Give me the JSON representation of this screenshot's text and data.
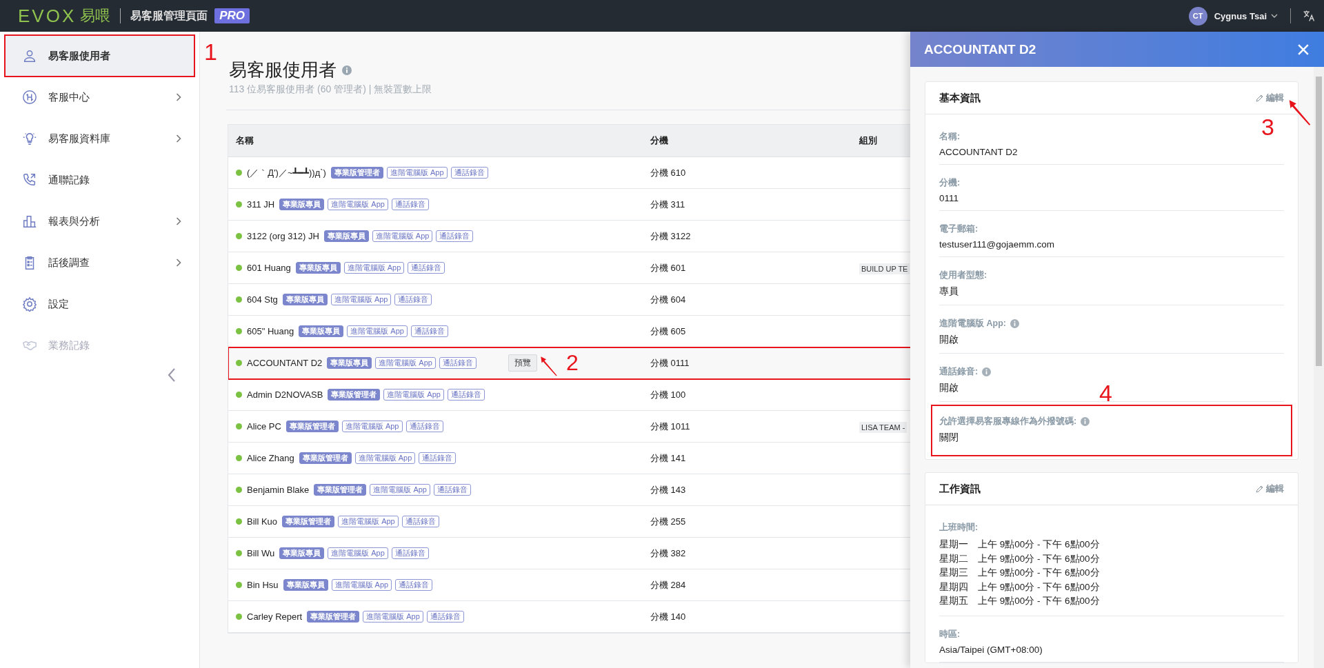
{
  "topbar": {
    "logo_mark": "EVOX",
    "logo_text": "易喂",
    "title": "易客服管理頁面",
    "badge": "PRO",
    "user": {
      "initials": "CT",
      "name": "Cygnus Tsai"
    }
  },
  "sidebar": {
    "items": [
      {
        "label": "易客服使用者",
        "selected": true,
        "disabled": false,
        "expandable": false,
        "callout": {
          "number": "1"
        }
      },
      {
        "label": "客服中心",
        "selected": false,
        "disabled": false,
        "expandable": true
      },
      {
        "label": "易客服資料庫",
        "selected": false,
        "disabled": false,
        "expandable": true
      },
      {
        "label": "通聯記錄",
        "selected": false,
        "disabled": false,
        "expandable": false
      },
      {
        "label": "報表與分析",
        "selected": false,
        "disabled": false,
        "expandable": true
      },
      {
        "label": "話後調查",
        "selected": false,
        "disabled": false,
        "expandable": true
      },
      {
        "label": "設定",
        "selected": false,
        "disabled": false,
        "expandable": false
      },
      {
        "label": "業務記錄",
        "selected": false,
        "disabled": true,
        "expandable": false
      }
    ]
  },
  "page": {
    "title": "易客服使用者",
    "subtitle": "113 位易客服使用者 (60 管理者) | 無裝置數上限"
  },
  "table": {
    "columns": [
      "名稱",
      "分機",
      "組別"
    ],
    "preview_label": "預覽",
    "rows": [
      {
        "name": "(／｀Д')／~┻━┻))д`)",
        "tags": [
          {
            "label": "專業版管理者",
            "kind": "filled"
          },
          {
            "label": "進階電腦版 App",
            "kind": "outline"
          },
          {
            "label": "通話錄音",
            "kind": "outline"
          }
        ],
        "extension": "分機 610",
        "selected": false
      },
      {
        "name": "311 JH",
        "tags": [
          {
            "label": "專業版專員",
            "kind": "filled"
          },
          {
            "label": "進階電腦版 App",
            "kind": "outline"
          },
          {
            "label": "通話錄音",
            "kind": "outline"
          }
        ],
        "extension": "分機 311",
        "selected": false
      },
      {
        "name": "3122 (org 312) JH",
        "tags": [
          {
            "label": "專業版專員",
            "kind": "filled"
          },
          {
            "label": "進階電腦版 App",
            "kind": "outline"
          },
          {
            "label": "通話錄音",
            "kind": "outline"
          }
        ],
        "extension": "分機 3122",
        "selected": false
      },
      {
        "name": "601 Huang",
        "tags": [
          {
            "label": "專業版專員",
            "kind": "filled"
          },
          {
            "label": "進階電腦版 App",
            "kind": "outline"
          },
          {
            "label": "通話錄音",
            "kind": "outline"
          }
        ],
        "extension": "分機 601",
        "group": "BUILD UP TE",
        "selected": false
      },
      {
        "name": "604 Stg",
        "tags": [
          {
            "label": "專業版專員",
            "kind": "filled"
          },
          {
            "label": "進階電腦版 App",
            "kind": "outline"
          },
          {
            "label": "通話錄音",
            "kind": "outline"
          }
        ],
        "extension": "分機 604",
        "selected": false
      },
      {
        "name": "605\" Huang",
        "tags": [
          {
            "label": "專業版專員",
            "kind": "filled"
          },
          {
            "label": "進階電腦版 App",
            "kind": "outline"
          },
          {
            "label": "通話錄音",
            "kind": "outline"
          }
        ],
        "extension": "分機 605",
        "selected": false
      },
      {
        "name": "ACCOUNTANT D2",
        "tags": [
          {
            "label": "專業版專員",
            "kind": "filled"
          },
          {
            "label": "進階電腦版 App",
            "kind": "outline"
          },
          {
            "label": "通話錄音",
            "kind": "outline"
          }
        ],
        "extension": "分機 0111",
        "selected": true,
        "callout": {
          "number": "2"
        }
      },
      {
        "name": "Admin D2NOVASB",
        "tags": [
          {
            "label": "專業版管理者",
            "kind": "filled"
          },
          {
            "label": "進階電腦版 App",
            "kind": "outline"
          },
          {
            "label": "通話錄音",
            "kind": "outline"
          }
        ],
        "extension": "分機 100",
        "selected": false
      },
      {
        "name": "Alice PC",
        "tags": [
          {
            "label": "專業版管理者",
            "kind": "filled"
          },
          {
            "label": "進階電腦版 App",
            "kind": "outline"
          },
          {
            "label": "通話錄音",
            "kind": "outline"
          }
        ],
        "extension": "分機 1011",
        "group": "LISA TEAM -",
        "selected": false
      },
      {
        "name": "Alice Zhang",
        "tags": [
          {
            "label": "專業版管理者",
            "kind": "filled"
          },
          {
            "label": "進階電腦版 App",
            "kind": "outline"
          },
          {
            "label": "通話錄音",
            "kind": "outline"
          }
        ],
        "extension": "分機 141",
        "selected": false
      },
      {
        "name": "Benjamin Blake",
        "tags": [
          {
            "label": "專業版管理者",
            "kind": "filled"
          },
          {
            "label": "進階電腦版 App",
            "kind": "outline"
          },
          {
            "label": "通話錄音",
            "kind": "outline"
          }
        ],
        "extension": "分機 143",
        "selected": false
      },
      {
        "name": "Bill Kuo",
        "tags": [
          {
            "label": "專業版管理者",
            "kind": "filled"
          },
          {
            "label": "進階電腦版 App",
            "kind": "outline"
          },
          {
            "label": "通話錄音",
            "kind": "outline"
          }
        ],
        "extension": "分機 255",
        "selected": false
      },
      {
        "name": "Bill Wu",
        "tags": [
          {
            "label": "專業版專員",
            "kind": "filled"
          },
          {
            "label": "進階電腦版 App",
            "kind": "outline"
          },
          {
            "label": "通話錄音",
            "kind": "outline"
          }
        ],
        "extension": "分機 382",
        "selected": false
      },
      {
        "name": "Bin Hsu",
        "tags": [
          {
            "label": "專業版專員",
            "kind": "filled"
          },
          {
            "label": "進階電腦版 App",
            "kind": "outline"
          },
          {
            "label": "通話錄音",
            "kind": "outline"
          }
        ],
        "extension": "分機 284",
        "selected": false
      },
      {
        "name": "Carley Repert",
        "tags": [
          {
            "label": "專業版管理者",
            "kind": "filled"
          },
          {
            "label": "進階電腦版 App",
            "kind": "outline"
          },
          {
            "label": "通話錄音",
            "kind": "outline"
          }
        ],
        "extension": "分機 140",
        "selected": false
      }
    ]
  },
  "panel": {
    "title": "ACCOUNTANT D2",
    "sections": [
      {
        "title": "基本資訊",
        "edit": "編輯",
        "edit_callout": {
          "number": "3"
        },
        "fields": [
          {
            "label": "名稱:",
            "value": "ACCOUNTANT D2",
            "info": false
          },
          {
            "label": "分機:",
            "value": "0111",
            "info": false
          },
          {
            "label": "電子郵箱:",
            "value": "testuser111@gojaemm.com",
            "info": false
          },
          {
            "label": "使用者型態:",
            "value": "專員",
            "info": false
          },
          {
            "label": "進階電腦版 App:",
            "value": "開啟",
            "info": true
          },
          {
            "label": "通話錄音:",
            "value": "開啟",
            "info": true
          },
          {
            "label": "允許選擇易客服專線作為外撥號碼:",
            "value": "關閉",
            "info": true,
            "callout": {
              "number": "4"
            }
          }
        ]
      },
      {
        "title": "工作資訊",
        "edit": "編輯",
        "fields": [
          {
            "label": "上班時間:",
            "schedule": [
              {
                "day": "星期一",
                "hours": "上午 9點00分 - 下午 6點00分"
              },
              {
                "day": "星期二",
                "hours": "上午 9點00分 - 下午 6點00分"
              },
              {
                "day": "星期三",
                "hours": "上午 9點00分 - 下午 6點00分"
              },
              {
                "day": "星期四",
                "hours": "上午 9點00分 - 下午 6點00分"
              },
              {
                "day": "星期五",
                "hours": "上午 9點00分 - 下午 6點00分"
              }
            ],
            "info": false
          },
          {
            "label": "時區:",
            "value": "Asia/Taipei (GMT+08:00)",
            "info": false
          }
        ]
      }
    ]
  }
}
